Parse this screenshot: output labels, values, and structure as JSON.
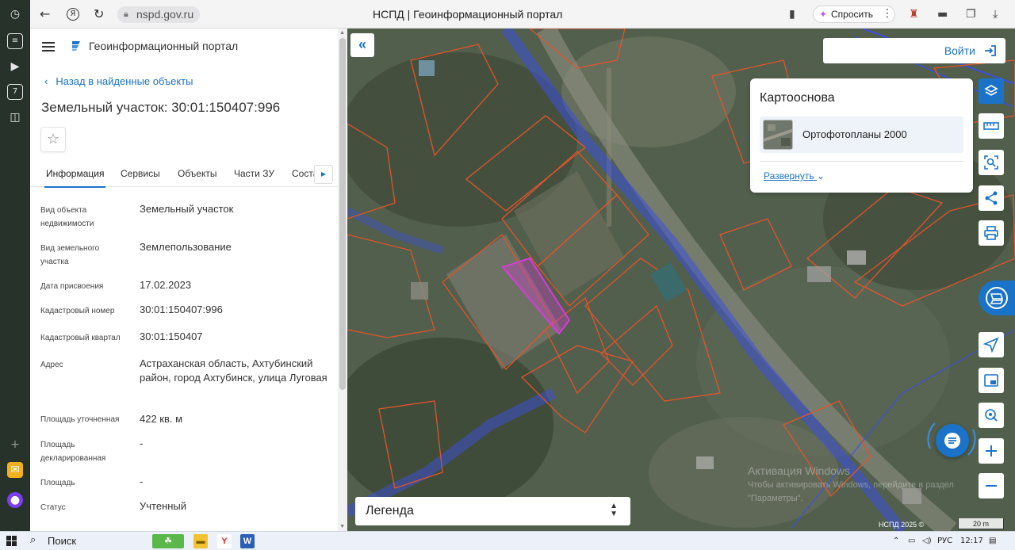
{
  "browser": {
    "url": "nspd.gov.ru",
    "page_title": "НСПД | Геоинформационный портал",
    "ask_label": "Спросить"
  },
  "panel": {
    "portal_title": "Геоинформационный портал",
    "back_label": "Назад в найденные объекты",
    "object_title": "Земельный участок: 30:01:150407:996",
    "tabs": [
      "Информация",
      "Сервисы",
      "Объекты",
      "Части ЗУ",
      "Соста"
    ],
    "properties": [
      {
        "label": "Вид объекта недвижимости",
        "value": "Земельный участок"
      },
      {
        "label": "Вид земельного участка",
        "value": "Землепользование"
      },
      {
        "label": "Дата присвоения",
        "value": "17.02.2023"
      },
      {
        "label": "Кадастровый номер",
        "value": "30:01:150407:996"
      },
      {
        "label": "Кадастровый квартал",
        "value": "30:01:150407"
      },
      {
        "label": "Адрес",
        "value": "Астраханская область, Ахтубинский район, город Ахтубинск, улица Луговая"
      },
      {
        "label": "Площадь уточненная",
        "value": "422 кв. м"
      },
      {
        "label": "Площадь декларированная",
        "value": "-"
      },
      {
        "label": "Площадь",
        "value": "-"
      },
      {
        "label": "Статус",
        "value": "Учтенный"
      }
    ]
  },
  "map": {
    "login_label": "Войти",
    "basemap_title": "Картооснова",
    "basemap_item": "Ортофотопланы 2000",
    "expand_label": "Развернуть",
    "legend_label": "Легенда",
    "copyright": "НСПД 2025 ©",
    "scale_label": "20 m",
    "watermark_title": "Активация Windows",
    "watermark_line1": "Чтобы активировать Windows, перейдите в раздел",
    "watermark_line2": "\"Параметры\"."
  },
  "taskbar": {
    "search_label": "Поиск",
    "language": "РУС",
    "time": "12:17"
  },
  "colors": {
    "accent": "#1a73c8",
    "parcel_outline": "#e2542d",
    "selected_parcel": "#d63dd6",
    "cadastral_block": "#3c50dc"
  }
}
